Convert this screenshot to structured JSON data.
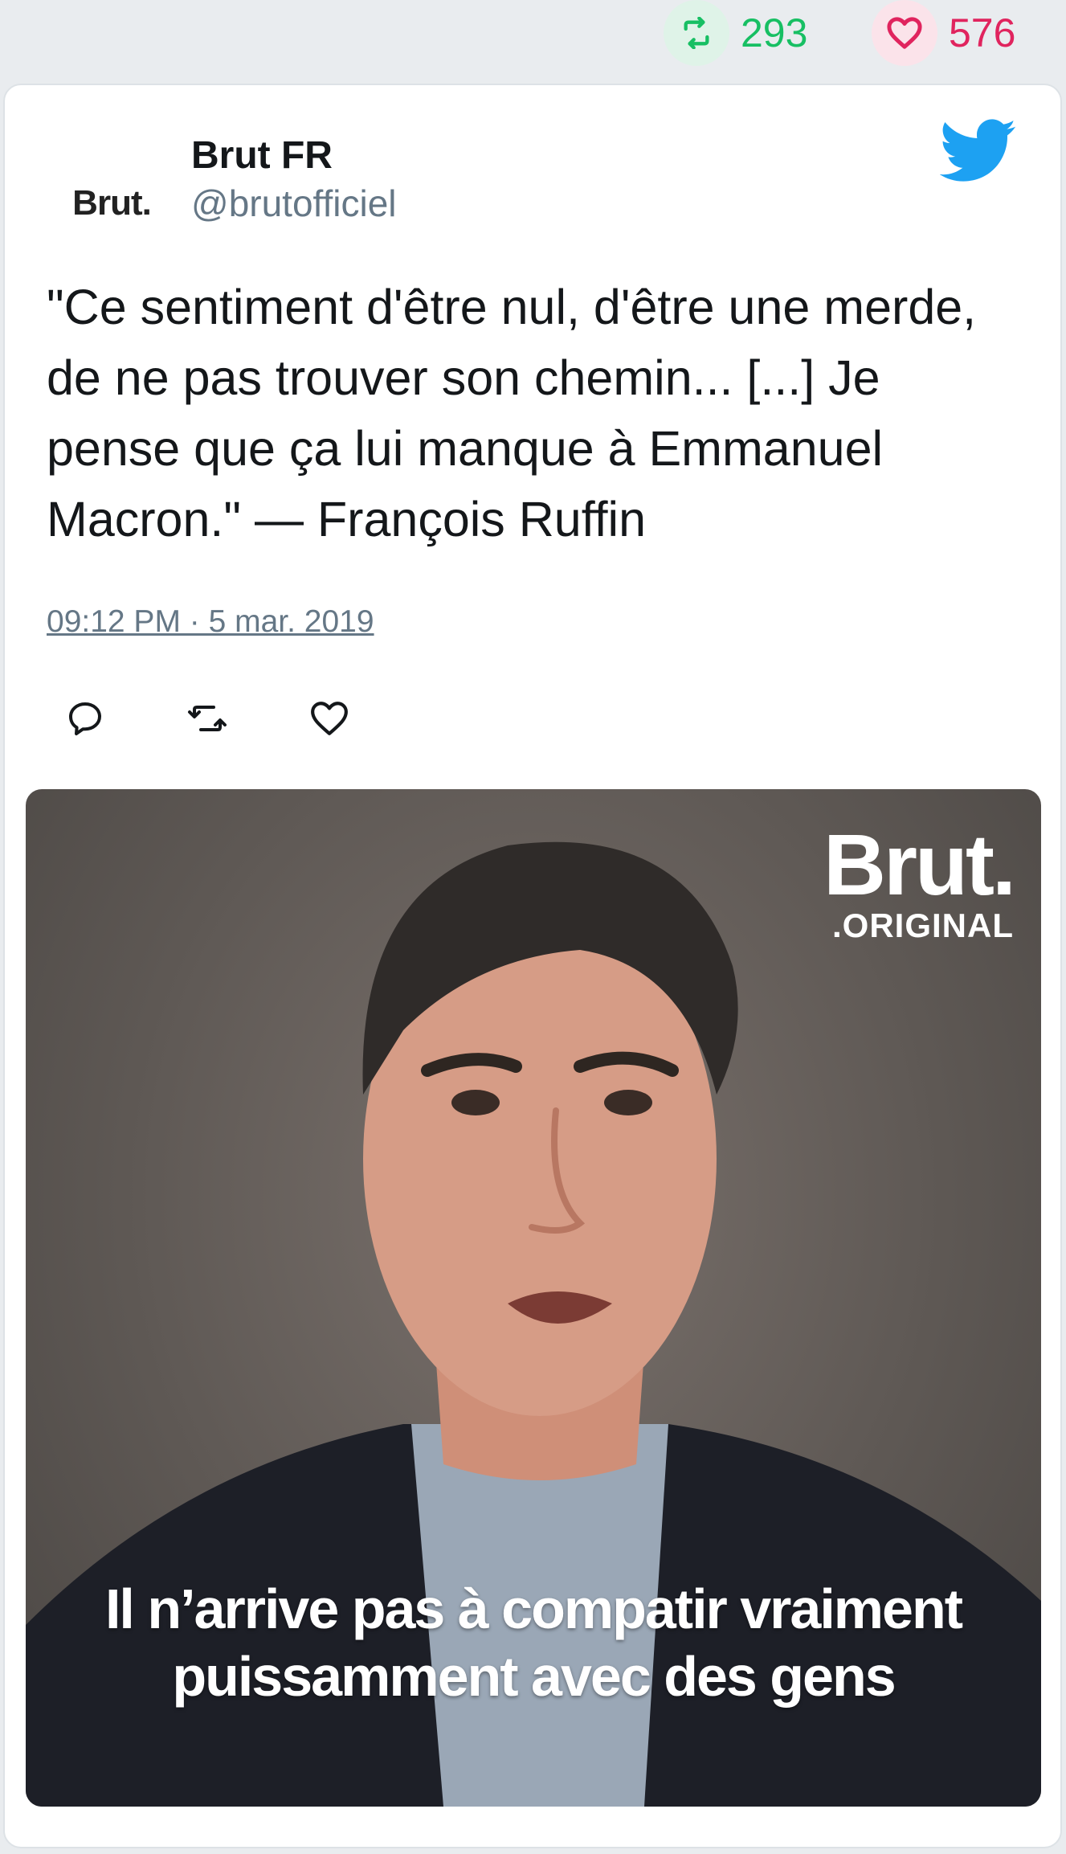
{
  "stats": {
    "retweet_count": "293",
    "like_count": "576",
    "retweet_color": "#17bf63",
    "like_color": "#e0245e"
  },
  "tweet": {
    "avatar_logo_text": "Brut.",
    "display_name": "Brut FR",
    "handle": "@brutofficiel",
    "text": "\"Ce sentiment d'être nul, d'être une merde, de ne pas trouver son chemin... [...] Je pense que ça lui manque à Emmanuel Macron.\" — François Ruffin",
    "timestamp": "09:12 PM · 5 mar. 2019",
    "icons": {
      "brand": "twitter-bird-icon",
      "reply": "reply-icon",
      "retweet": "retweet-icon",
      "like": "heart-icon"
    }
  },
  "media": {
    "brand_line1": "Brut.",
    "brand_line2": ".ORIGINAL",
    "caption_line1": "Il n’arrive pas à compatir vraiment",
    "caption_line2": "puissamment avec des gens"
  }
}
